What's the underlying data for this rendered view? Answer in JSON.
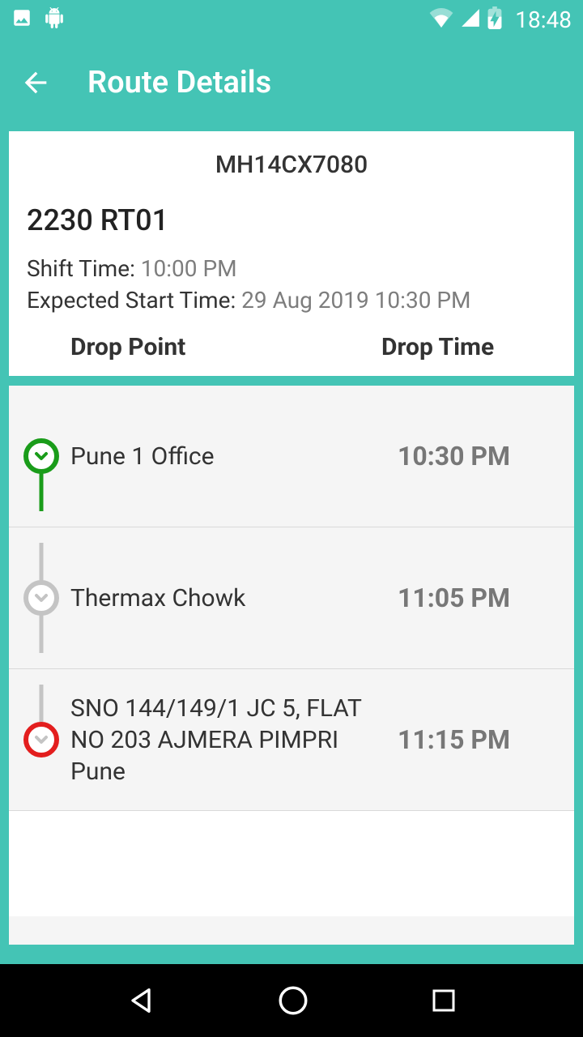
{
  "status": {
    "time": "18:48"
  },
  "header": {
    "title": "Route Details"
  },
  "info": {
    "vehicle_no": "MH14CX7080",
    "route_name": "2230 RT01",
    "shift_label": "Shift Time: ",
    "shift_value": "10:00 PM",
    "expected_label": "Expected Start Time: ",
    "expected_value": "29 Aug 2019 10:30 PM"
  },
  "columns": {
    "point": "Drop Point",
    "time": "Drop Time"
  },
  "stops": [
    {
      "name": "Pune 1 Office",
      "time": "10:30 PM"
    },
    {
      "name": "Thermax Chowk",
      "time": "11:05 PM"
    },
    {
      "name": "SNO 144/149/1 JC 5, FLAT NO 203 AJMERA PIMPRI Pune",
      "time": "11:15 PM"
    }
  ]
}
